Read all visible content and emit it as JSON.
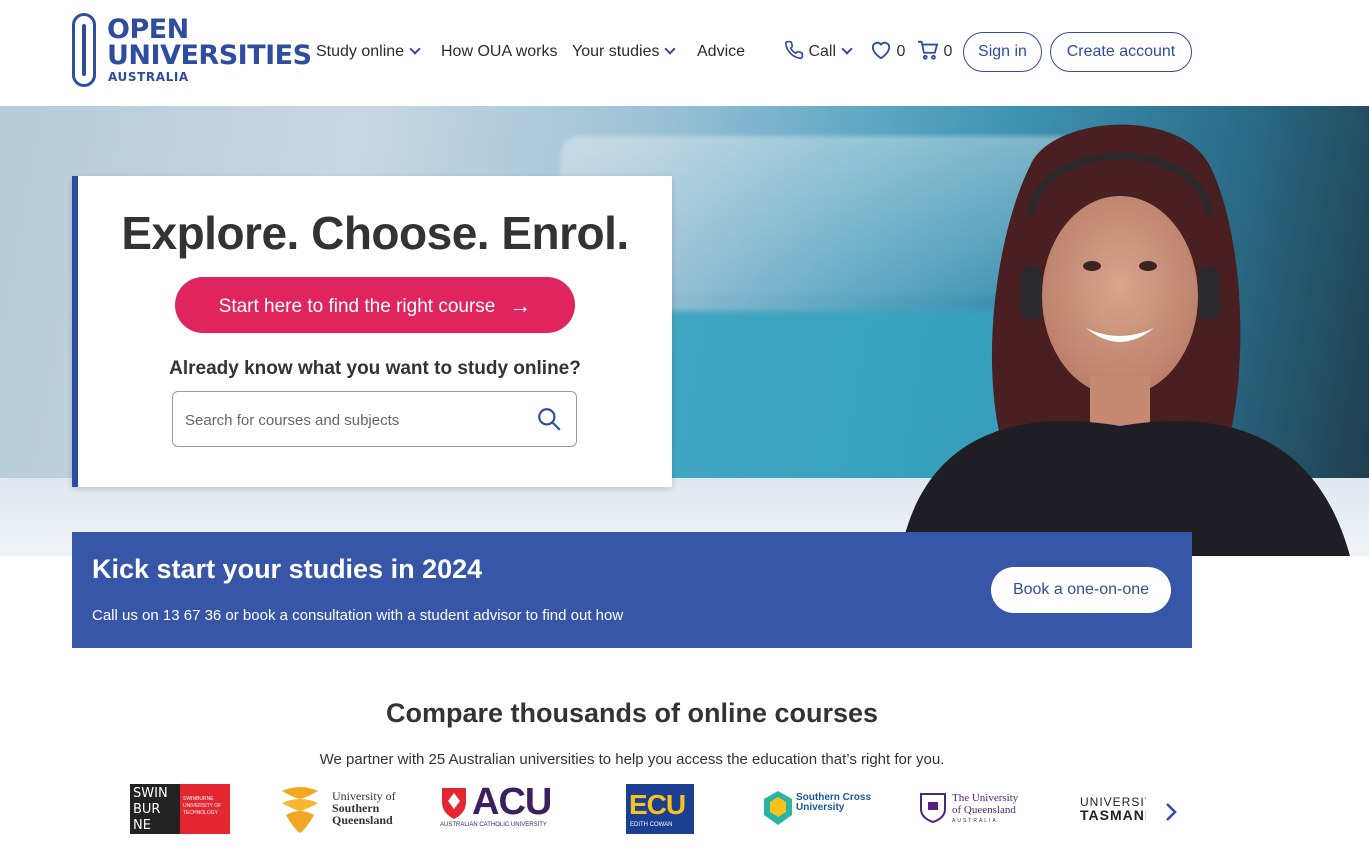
{
  "brand": {
    "line1": "OPEN",
    "line2": "UNIVERSITIES",
    "line3": "AUSTRALIA"
  },
  "nav": {
    "study_online": "Study online",
    "how_oua_works": "How OUA works",
    "your_studies": "Your studies",
    "advice": "Advice",
    "call": "Call",
    "favourites_count": "0",
    "cart_count": "0",
    "sign_in": "Sign in",
    "create_account": "Create account"
  },
  "hero": {
    "title": "Explore. Choose. Enrol.",
    "cta_label": "Start here to find the right course",
    "search_heading": "Already know what you want to study online?",
    "search_placeholder": "Search for courses and subjects"
  },
  "banner": {
    "title": "Kick start your studies in 2024",
    "subtitle": "Call us on 13 67 36 or book a consultation with a student advisor to find out how",
    "button_label": "Book a one-on-one"
  },
  "compare": {
    "title": "Compare thousands of online courses",
    "subtitle": "We partner with 25 Australian universities to help you access the education that’s right for you."
  },
  "universities": [
    {
      "name": "Swinburne University of Technology",
      "mark": "SWIN BUR NE",
      "tag": "SWINBURNE UNIVERSITY OF TECHNOLOGY"
    },
    {
      "name": "University of Southern Queensland",
      "line1": "University of",
      "line2": "Southern",
      "line3": "Queensland"
    },
    {
      "name": "Australian Catholic University",
      "mark": "ACU",
      "tag": "AUSTRALIAN CATHOLIC UNIVERSITY"
    },
    {
      "name": "Edith Cowan University",
      "mark": "ECU",
      "tag": "EDITH COWAN"
    },
    {
      "name": "Southern Cross University",
      "line1": "Southern Cross",
      "line2": "University"
    },
    {
      "name": "The University of Queensland",
      "line1": "The University",
      "line2": "of Queensland",
      "tag": "AUSTRALIA"
    },
    {
      "name": "University of Tasmania",
      "line1": "UNIVERSITY",
      "line2": "TASMANIA"
    }
  ],
  "colors": {
    "primary_blue": "#2f4d9e",
    "banner_blue": "#3756a8",
    "cta_pink": "#e0245e"
  }
}
